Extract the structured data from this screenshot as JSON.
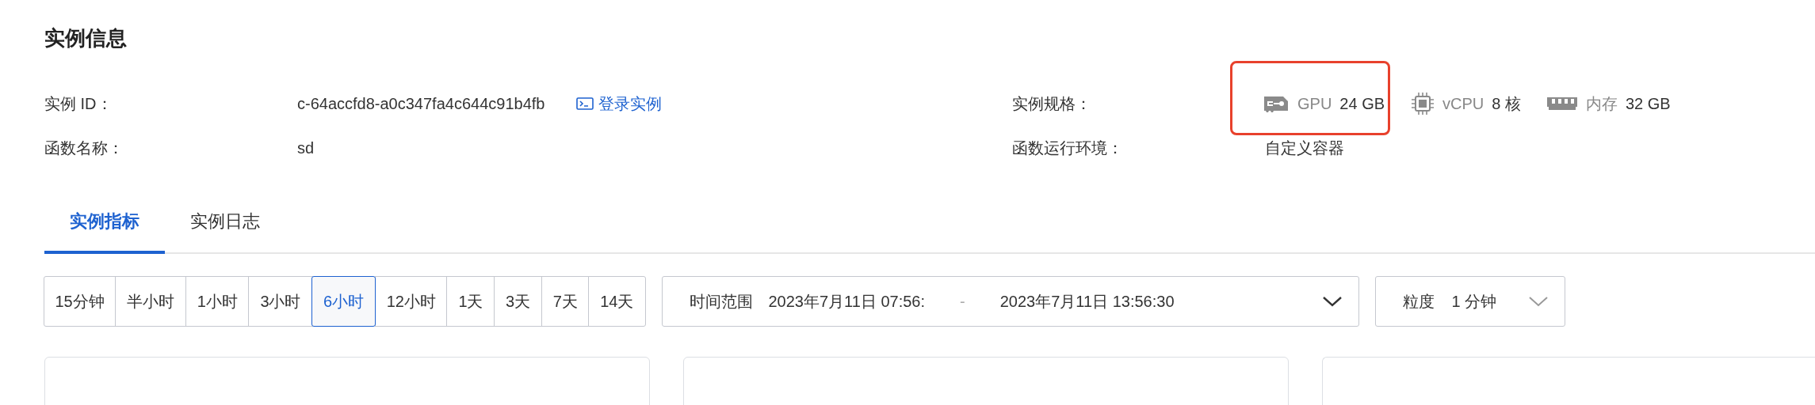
{
  "section_title": "实例信息",
  "info_left": [
    {
      "label": "实例 ID：",
      "value": "c-64accfd8-a0c347fa4c644c91b4fb",
      "link": "登录实例"
    },
    {
      "label": "函数名称：",
      "value": "sd"
    }
  ],
  "info_right": [
    {
      "label": "实例规格：",
      "specs": [
        {
          "kind": "gpu",
          "name": "GPU",
          "value": "24 GB",
          "highlighted": true
        },
        {
          "kind": "cpu",
          "name": "vCPU",
          "value": "8 核",
          "highlighted": false
        },
        {
          "kind": "memory",
          "name": "内存",
          "value": "32 GB",
          "highlighted": false
        }
      ]
    },
    {
      "label": "函数运行环境：",
      "value": "自定义容器"
    }
  ],
  "tabs": [
    {
      "label": "实例指标",
      "selected": true
    },
    {
      "label": "实例日志",
      "selected": false
    }
  ],
  "time_ranges": [
    {
      "label": "15分钟",
      "selected": false
    },
    {
      "label": "半小时",
      "selected": false
    },
    {
      "label": "1小时",
      "selected": false
    },
    {
      "label": "3小时",
      "selected": false
    },
    {
      "label": "6小时",
      "selected": true
    },
    {
      "label": "12小时",
      "selected": false
    },
    {
      "label": "1天",
      "selected": false
    },
    {
      "label": "3天",
      "selected": false
    },
    {
      "label": "7天",
      "selected": false
    },
    {
      "label": "14天",
      "selected": false
    }
  ],
  "date_range": {
    "label": "时间范围",
    "start": "2023年7月11日 07:56:",
    "separator": "-",
    "end": "2023年7月11日 13:56:30"
  },
  "granularity": {
    "label": "粒度",
    "value": "1 分钟"
  }
}
